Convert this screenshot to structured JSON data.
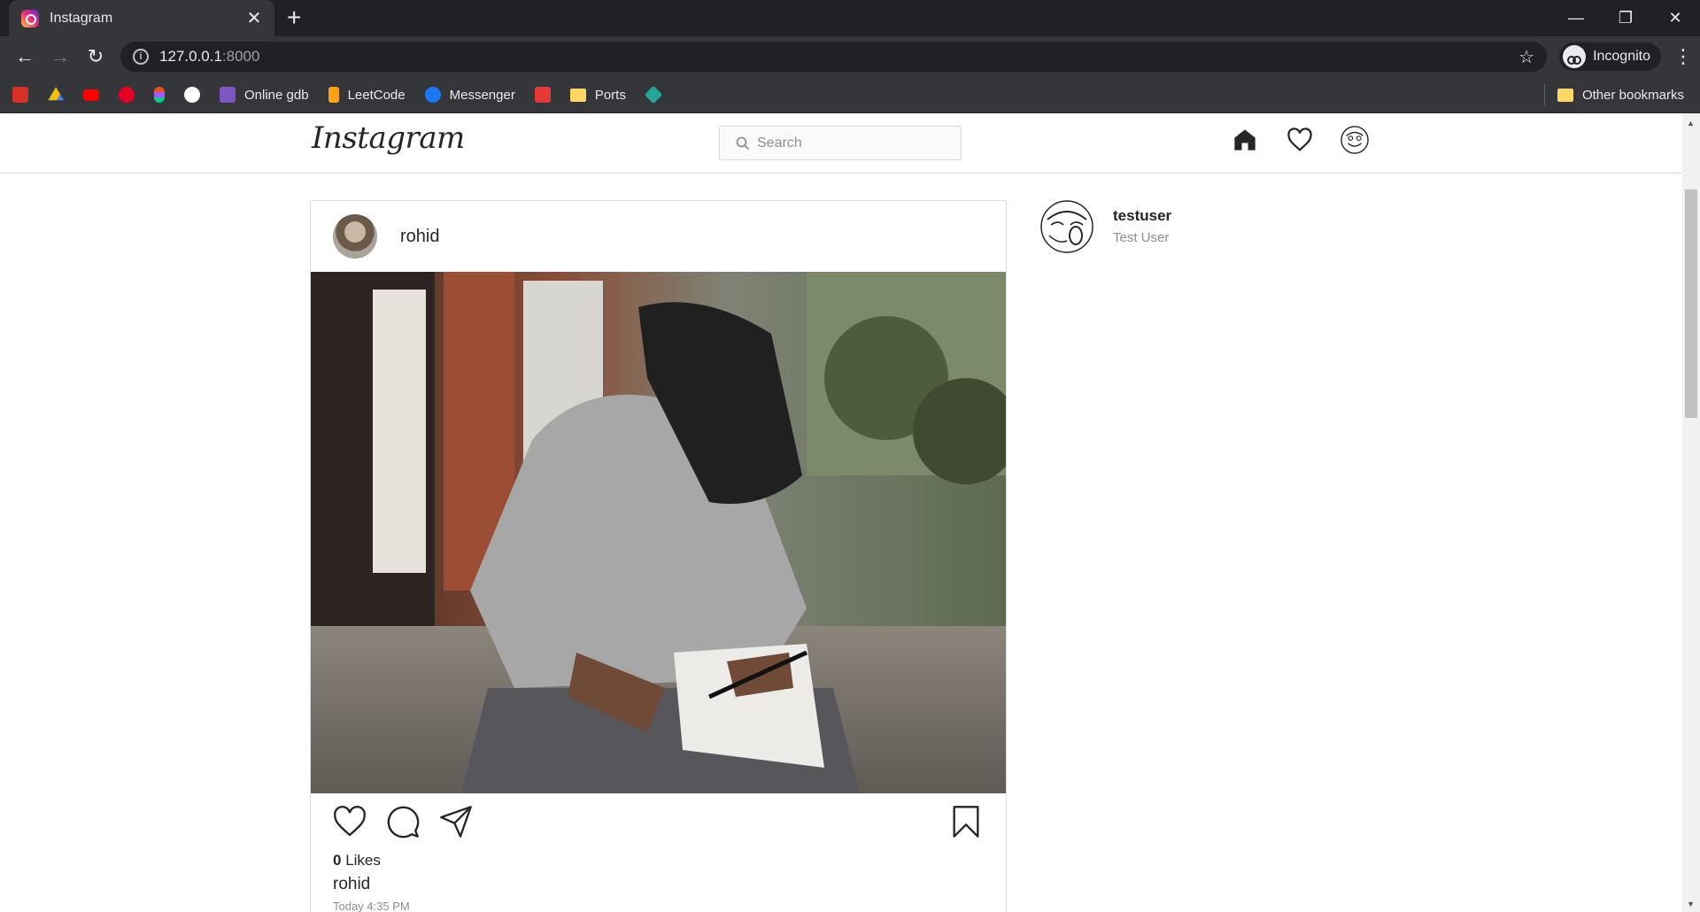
{
  "browser": {
    "tab_title": "Instagram",
    "url_host": "127.0.0.1",
    "url_port": ":8000",
    "profile_label": "Incognito",
    "bookmarks": [
      {
        "label": "",
        "icon": "gmail-icon",
        "color": "#d93025"
      },
      {
        "label": "",
        "icon": "drive-icon",
        "color": "#1e8e3e"
      },
      {
        "label": "",
        "icon": "youtube-icon",
        "color": "#ff0000"
      },
      {
        "label": "",
        "icon": "pinterest-icon",
        "color": "#e60023"
      },
      {
        "label": "",
        "icon": "figma-icon",
        "color": "#f24e1e"
      },
      {
        "label": "",
        "icon": "github-icon",
        "color": "#ffffff"
      },
      {
        "label": "Online gdb",
        "icon": "onlinegdb-icon",
        "color": "#7e57c2"
      },
      {
        "label": "LeetCode",
        "icon": "leetcode-icon",
        "color": "#ffa116"
      },
      {
        "label": "Messenger",
        "icon": "messenger-icon",
        "color": "#1877f2"
      },
      {
        "label": "",
        "icon": "download-icon",
        "color": "#e53935"
      },
      {
        "label": "Ports",
        "icon": "folder-icon",
        "color": "#fdd663"
      },
      {
        "label": "",
        "icon": "diamond-icon",
        "color": "#26a69a"
      }
    ],
    "other_bookmarks": "Other bookmarks"
  },
  "header": {
    "logo": "Instagram",
    "search_placeholder": "Search"
  },
  "post": {
    "username": "rohid",
    "likes_count": "0",
    "likes_label": "Likes",
    "caption_user": "rohid",
    "timestamp": "Today 4:35 PM"
  },
  "sidebar": {
    "username": "testuser",
    "full_name": "Test User"
  }
}
